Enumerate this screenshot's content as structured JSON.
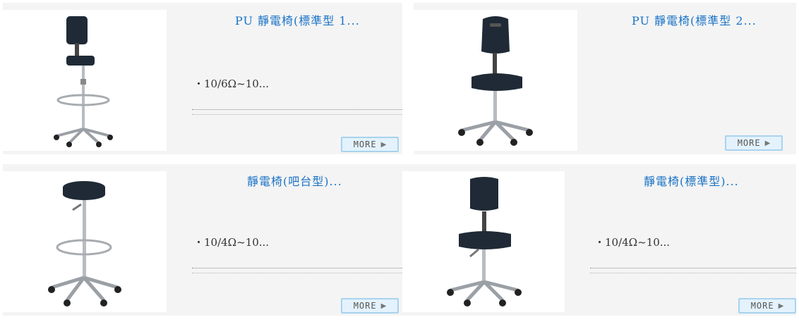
{
  "products": [
    {
      "title": "PU 靜電椅(標準型 1...",
      "spec": "・10/6Ω~10...",
      "more_label": "MORE",
      "image": "tall-drafting-chair-with-footring"
    },
    {
      "title": "PU 靜電椅(標準型 2...",
      "spec": "",
      "more_label": "MORE",
      "image": "task-chair-pu"
    },
    {
      "title": "靜電椅(吧台型)...",
      "spec": "・10/4Ω~10...",
      "more_label": "MORE",
      "image": "bar-stool-with-footring"
    },
    {
      "title": "靜電椅(標準型)...",
      "spec": "・10/4Ω~10...",
      "more_label": "MORE",
      "image": "task-chair-standard"
    }
  ],
  "more_arrow": "▶",
  "colors": {
    "title": "#1a73c6",
    "card_bg": "#f4f4f4",
    "button_bg": "#e3f2fc",
    "button_border": "#a8d3ee"
  }
}
